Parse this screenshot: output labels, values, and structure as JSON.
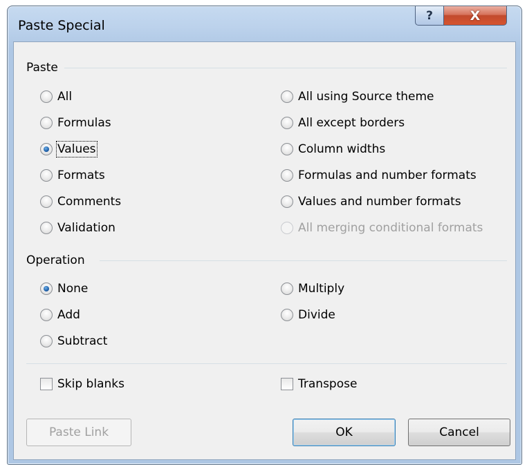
{
  "window": {
    "title": "Paste Special",
    "help_label": "?",
    "close_label": "X"
  },
  "paste_group": {
    "label": "Paste",
    "left_options": [
      {
        "label": "All",
        "checked": false,
        "disabled": false
      },
      {
        "label": "Formulas",
        "checked": false,
        "disabled": false
      },
      {
        "label": "Values",
        "checked": true,
        "disabled": false
      },
      {
        "label": "Formats",
        "checked": false,
        "disabled": false
      },
      {
        "label": "Comments",
        "checked": false,
        "disabled": false
      },
      {
        "label": "Validation",
        "checked": false,
        "disabled": false
      }
    ],
    "right_options": [
      {
        "label": "All using Source theme",
        "checked": false,
        "disabled": false
      },
      {
        "label": "All except borders",
        "checked": false,
        "disabled": false
      },
      {
        "label": "Column widths",
        "checked": false,
        "disabled": false
      },
      {
        "label": "Formulas and number formats",
        "checked": false,
        "disabled": false
      },
      {
        "label": "Values and number formats",
        "checked": false,
        "disabled": false
      },
      {
        "label": "All merging conditional formats",
        "checked": false,
        "disabled": true
      }
    ]
  },
  "operation_group": {
    "label": "Operation",
    "left_options": [
      {
        "label": "None",
        "checked": true
      },
      {
        "label": "Add",
        "checked": false
      },
      {
        "label": "Subtract",
        "checked": false
      }
    ],
    "right_options": [
      {
        "label": "Multiply",
        "checked": false
      },
      {
        "label": "Divide",
        "checked": false
      }
    ]
  },
  "checkboxes": {
    "skip_blanks": {
      "label": "Skip blanks",
      "checked": false
    },
    "transpose": {
      "label": "Transpose",
      "checked": false
    }
  },
  "buttons": {
    "paste_link": "Paste Link",
    "ok": "OK",
    "cancel": "Cancel"
  }
}
